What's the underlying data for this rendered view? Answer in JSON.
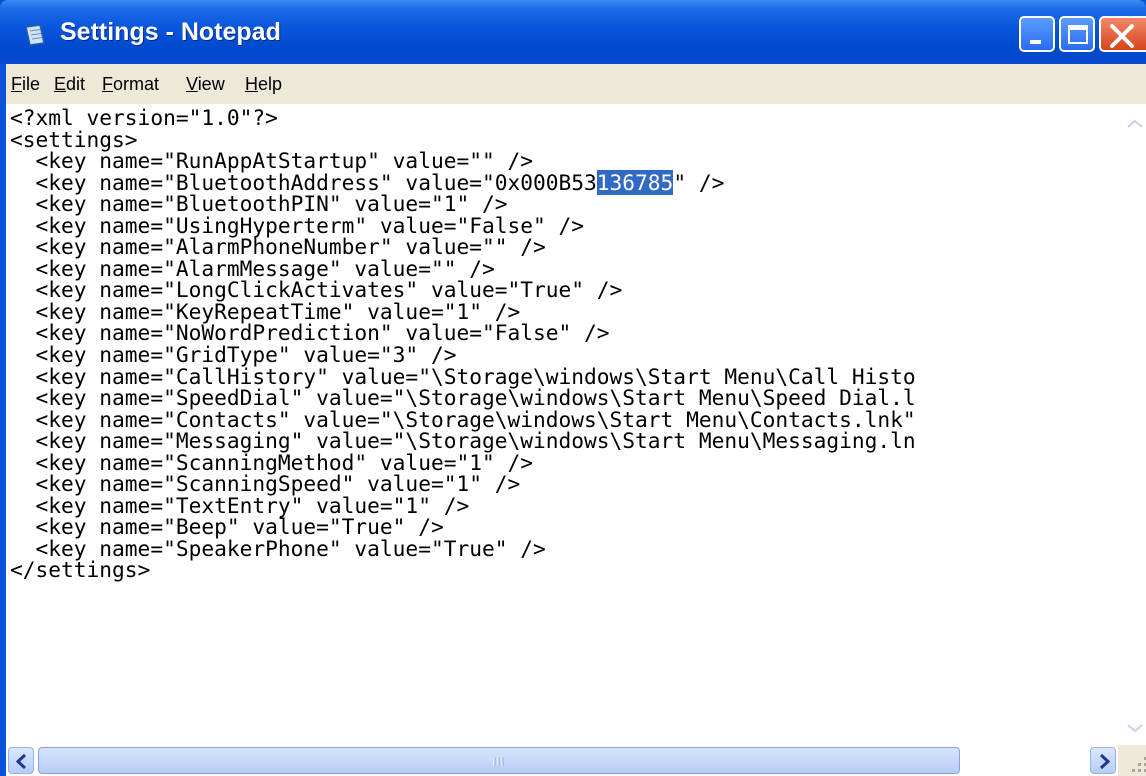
{
  "window": {
    "title": "Settings - Notepad"
  },
  "menu": {
    "items": [
      "File",
      "Edit",
      "Format",
      "View",
      "Help"
    ]
  },
  "document": {
    "lines_before": [
      "<?xml version=\"1.0\"?>",
      "<settings>",
      "  <key name=\"RunAppAtStartup\" value=\"\" />"
    ],
    "selected_line": {
      "before": "  <key name=\"BluetoothAddress\" value=\"0x000B53",
      "selected": "136785",
      "after": "\" />"
    },
    "lines_after": [
      "  <key name=\"BluetoothPIN\" value=\"1\" />",
      "  <key name=\"UsingHyperterm\" value=\"False\" />",
      "  <key name=\"AlarmPhoneNumber\" value=\"\" />",
      "  <key name=\"AlarmMessage\" value=\"\" />",
      "  <key name=\"LongClickActivates\" value=\"True\" />",
      "  <key name=\"KeyRepeatTime\" value=\"1\" />",
      "  <key name=\"NoWordPrediction\" value=\"False\" />",
      "  <key name=\"GridType\" value=\"3\" />",
      "  <key name=\"CallHistory\" value=\"\\Storage\\windows\\Start Menu\\Call Histo",
      "  <key name=\"SpeedDial\" value=\"\\Storage\\windows\\Start Menu\\Speed Dial.l",
      "  <key name=\"Contacts\" value=\"\\Storage\\windows\\Start Menu\\Contacts.lnk\"",
      "  <key name=\"Messaging\" value=\"\\Storage\\windows\\Start Menu\\Messaging.ln",
      "  <key name=\"ScanningMethod\" value=\"1\" />",
      "  <key name=\"ScanningSpeed\" value=\"1\" />",
      "  <key name=\"TextEntry\" value=\"1\" />",
      "  <key name=\"Beep\" value=\"True\" />",
      "  <key name=\"SpeakerPhone\" value=\"True\" />",
      "</settings>"
    ]
  },
  "colors": {
    "title_bar": "#0a56df",
    "selection": "#316ac5",
    "menu_background": "#ece9d8",
    "close_button": "#d8421e"
  },
  "icons": {
    "app": "notepad-icon",
    "minimize": "minimize-icon",
    "maximize": "maximize-icon",
    "close": "close-icon",
    "scroll_up": "arrow-up-icon",
    "scroll_down": "arrow-down-icon",
    "scroll_left": "arrow-left-icon",
    "scroll_right": "arrow-right-icon"
  }
}
